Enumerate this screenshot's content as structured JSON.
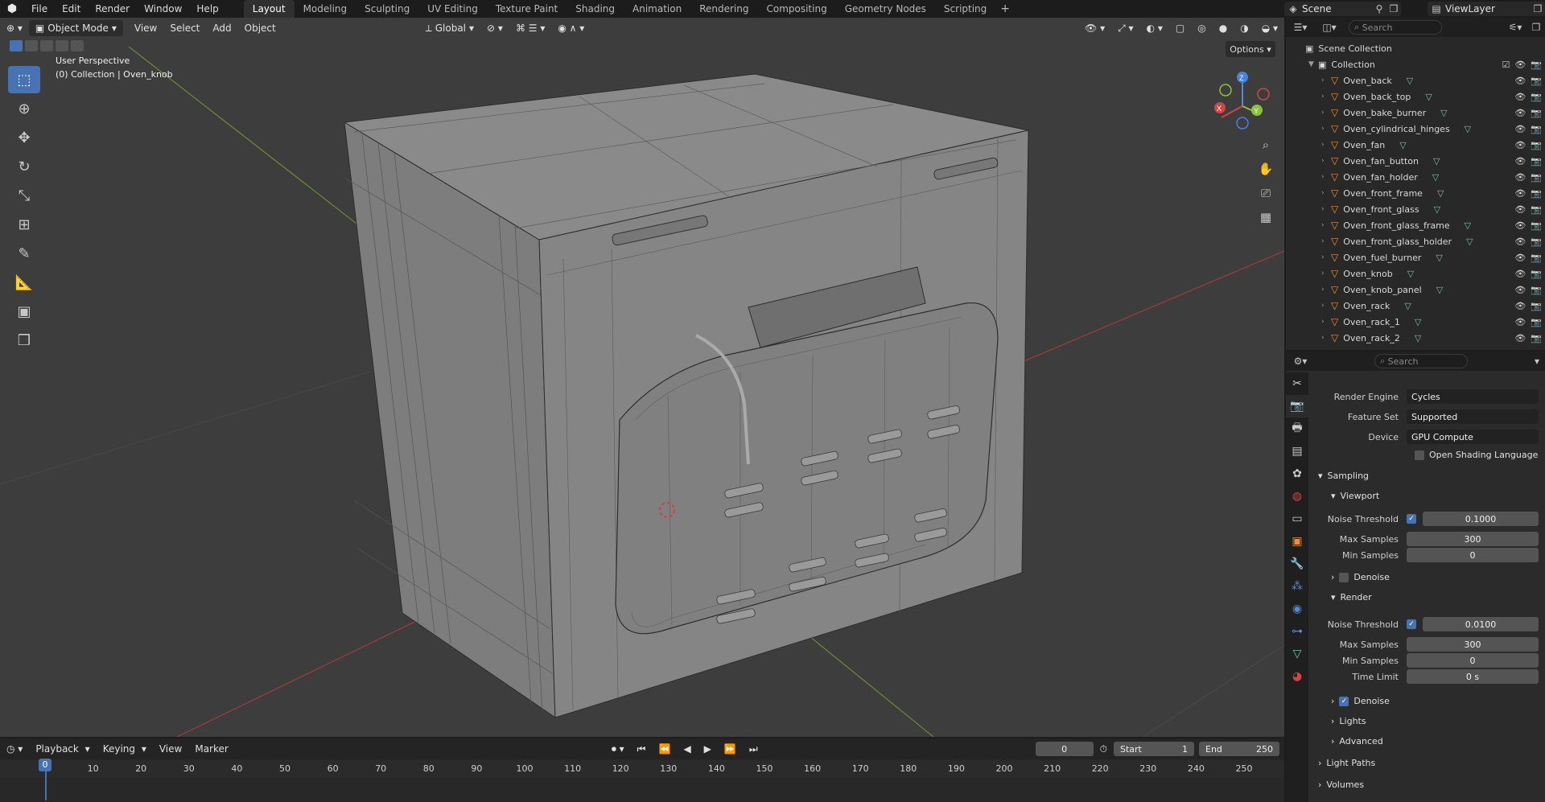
{
  "top_menu": [
    "File",
    "Edit",
    "Render",
    "Window",
    "Help"
  ],
  "workspace_tabs": [
    {
      "label": "Layout",
      "active": true
    },
    {
      "label": "Modeling"
    },
    {
      "label": "Sculpting"
    },
    {
      "label": "UV Editing"
    },
    {
      "label": "Texture Paint"
    },
    {
      "label": "Shading"
    },
    {
      "label": "Animation"
    },
    {
      "label": "Rendering"
    },
    {
      "label": "Compositing"
    },
    {
      "label": "Geometry Nodes"
    },
    {
      "label": "Scripting"
    }
  ],
  "scene": "Scene",
  "view_layer": "ViewLayer",
  "viewport": {
    "mode": "Object Mode",
    "menus": [
      "View",
      "Select",
      "Add",
      "Object"
    ],
    "transform_orientation": "Global",
    "options": "Options",
    "overlay_line1": "User Perspective",
    "overlay_line2": "(0) Collection | Oven_knob",
    "gizmo": {
      "x": "X",
      "y": "Y",
      "z": "Z"
    }
  },
  "outliner": {
    "search_placeholder": "Search",
    "scene_collection": "Scene Collection",
    "collection": "Collection",
    "objects": [
      "Oven_back",
      "Oven_back_top",
      "Oven_bake_burner",
      "Oven_cylindrical_hinges",
      "Oven_fan",
      "Oven_fan_button",
      "Oven_fan_holder",
      "Oven_front_frame",
      "Oven_front_glass",
      "Oven_front_glass_frame",
      "Oven_front_glass_holder",
      "Oven_fuel_burner",
      "Oven_knob",
      "Oven_knob_panel",
      "Oven_rack",
      "Oven_rack_1",
      "Oven_rack_2"
    ]
  },
  "properties": {
    "search_placeholder": "Search",
    "render_engine_label": "Render Engine",
    "render_engine": "Cycles",
    "feature_set_label": "Feature Set",
    "feature_set": "Supported",
    "device_label": "Device",
    "device": "GPU Compute",
    "osl_label": "Open Shading Language",
    "sampling": "Sampling",
    "viewport_section": "Viewport",
    "render_section": "Render",
    "noise_threshold_label": "Noise Threshold",
    "max_samples_label": "Max Samples",
    "min_samples_label": "Min Samples",
    "time_limit_label": "Time Limit",
    "denoise_label": "Denoise",
    "viewport_noise_threshold": "0.1000",
    "viewport_max_samples": "300",
    "viewport_min_samples": "0",
    "render_noise_threshold": "0.0100",
    "render_max_samples": "300",
    "render_min_samples": "0",
    "render_time_limit": "0 s",
    "lights": "Lights",
    "advanced": "Advanced",
    "light_paths": "Light Paths",
    "volumes": "Volumes"
  },
  "timeline": {
    "menus": [
      "Playback",
      "Keying",
      "View",
      "Marker"
    ],
    "current_frame": "0",
    "start_label": "Start",
    "start": "1",
    "end_label": "End",
    "end": "250",
    "ticks": [
      "10",
      "20",
      "30",
      "40",
      "50",
      "60",
      "70",
      "80",
      "90",
      "100",
      "110",
      "120",
      "130",
      "140",
      "150",
      "160",
      "170",
      "180",
      "190",
      "200",
      "210",
      "220",
      "230",
      "240",
      "250"
    ],
    "playhead_label": "0"
  }
}
